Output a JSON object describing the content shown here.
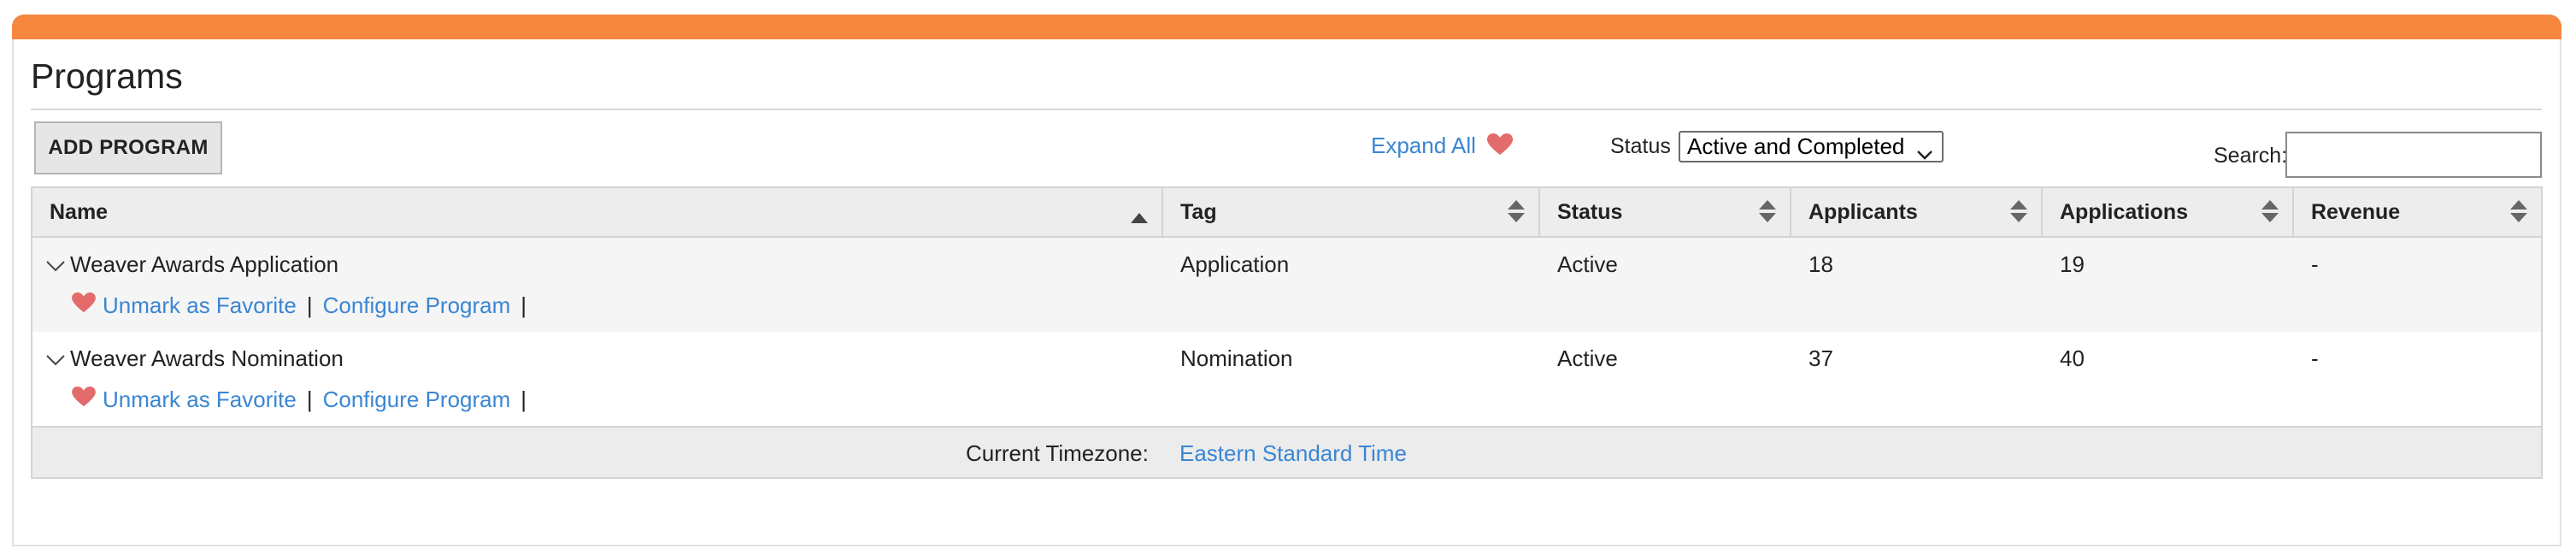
{
  "page_title": "Programs",
  "toolbar": {
    "add_program_label": "ADD PROGRAM",
    "expand_all_label": "Expand All",
    "status_label": "Status",
    "status_selected": "Active and Completed",
    "search_label": "Search:",
    "search_value": ""
  },
  "table": {
    "columns": [
      "Name",
      "Tag",
      "Status",
      "Applicants",
      "Applications",
      "Revenue"
    ],
    "rows": [
      {
        "name": "Weaver Awards Application",
        "tag": "Application",
        "status": "Active",
        "applicants": "18",
        "applications": "19",
        "revenue": "-",
        "unmark_label": "Unmark as Favorite",
        "configure_label": "Configure Program",
        "sep": "|"
      },
      {
        "name": "Weaver Awards Nomination",
        "tag": "Nomination",
        "status": "Active",
        "applicants": "37",
        "applications": "40",
        "revenue": "-",
        "unmark_label": "Unmark as Favorite",
        "configure_label": "Configure Program",
        "sep": "|"
      }
    ],
    "footer": {
      "timezone_label": "Current Timezone:",
      "timezone_value": "Eastern Standard Time"
    }
  },
  "colors": {
    "accent_bar": "#f5873f",
    "link": "#3a86d4",
    "heart": "#e36b6b"
  },
  "icons": {
    "favorite": "heart-icon",
    "sort_both": "sort-icon",
    "sort_asc": "sort-asc-icon",
    "collapse": "chevron-down-icon"
  }
}
